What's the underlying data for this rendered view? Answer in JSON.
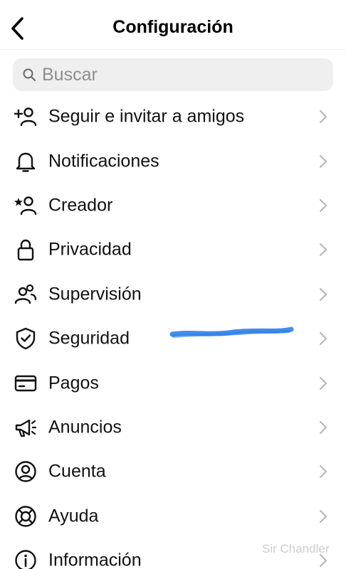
{
  "header": {
    "title": "Configuración",
    "back_icon": "chevron-left-icon"
  },
  "search": {
    "placeholder": "Buscar",
    "value": ""
  },
  "menu": {
    "items": [
      {
        "label": "Seguir e invitar a amigos",
        "icon": "add-person-icon"
      },
      {
        "label": "Notificaciones",
        "icon": "bell-icon"
      },
      {
        "label": "Creador",
        "icon": "creator-star-person-icon"
      },
      {
        "label": "Privacidad",
        "icon": "lock-icon"
      },
      {
        "label": "Supervisión",
        "icon": "people-icon"
      },
      {
        "label": "Seguridad",
        "icon": "shield-check-icon"
      },
      {
        "label": "Pagos",
        "icon": "credit-card-icon"
      },
      {
        "label": "Anuncios",
        "icon": "megaphone-icon"
      },
      {
        "label": "Cuenta",
        "icon": "account-circle-icon"
      },
      {
        "label": "Ayuda",
        "icon": "lifebuoy-icon"
      },
      {
        "label": "Información",
        "icon": "info-icon"
      }
    ]
  },
  "redaction_color": "#2f7fe6",
  "watermark": "Sir Chandler"
}
